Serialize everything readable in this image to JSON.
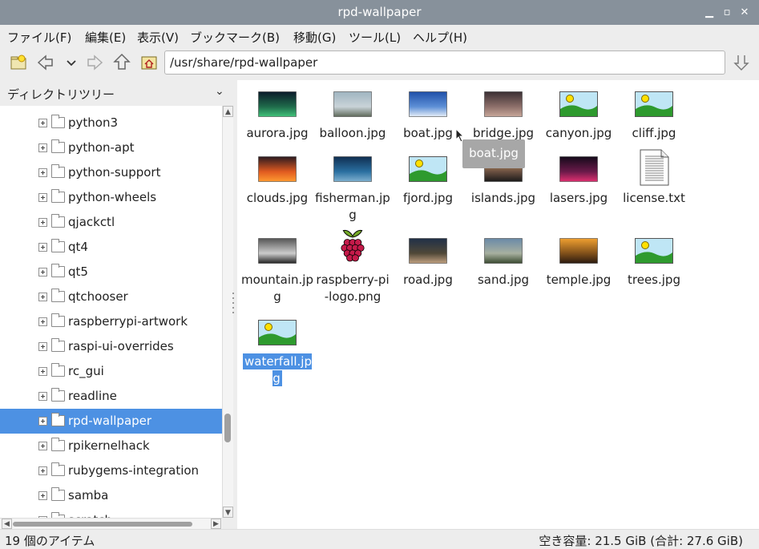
{
  "window": {
    "title": "rpd-wallpaper"
  },
  "menu": [
    "ファイル(F)",
    "編集(E)",
    "表示(V)",
    "ブックマーク(B)",
    "移動(G)",
    "ツール(L)",
    "ヘルプ(H)"
  ],
  "toolbar": {
    "path": "/usr/share/rpd-wallpaper",
    "icons": [
      "new-tab-icon",
      "back-icon",
      "history-dropdown-icon",
      "forward-icon",
      "up-icon",
      "home-icon",
      "go-icon"
    ]
  },
  "sidebar": {
    "header": "ディレクトリツリー",
    "items": [
      {
        "label": "python3",
        "selected": false
      },
      {
        "label": "python-apt",
        "selected": false
      },
      {
        "label": "python-support",
        "selected": false
      },
      {
        "label": "python-wheels",
        "selected": false
      },
      {
        "label": "qjackctl",
        "selected": false
      },
      {
        "label": "qt4",
        "selected": false
      },
      {
        "label": "qt5",
        "selected": false
      },
      {
        "label": "qtchooser",
        "selected": false
      },
      {
        "label": "raspberrypi-artwork",
        "selected": false
      },
      {
        "label": "raspi-ui-overrides",
        "selected": false
      },
      {
        "label": "rc_gui",
        "selected": false
      },
      {
        "label": "readline",
        "selected": false
      },
      {
        "label": "rpd-wallpaper",
        "selected": true
      },
      {
        "label": "rpikernelhack",
        "selected": false
      },
      {
        "label": "rubygems-integration",
        "selected": false
      },
      {
        "label": "samba",
        "selected": false
      },
      {
        "label": "scratch",
        "selected": false
      }
    ]
  },
  "files": [
    {
      "name": "aurora.jpg",
      "thumb": "photo-aurora"
    },
    {
      "name": "balloon.jpg",
      "thumb": "photo-balloon"
    },
    {
      "name": "boat.jpg",
      "thumb": "photo-boat"
    },
    {
      "name": "bridge.jpg",
      "thumb": "photo-bridge"
    },
    {
      "name": "canyon.jpg",
      "thumb": "image-placeholder"
    },
    {
      "name": "cliff.jpg",
      "thumb": "image-placeholder"
    },
    {
      "name": "clouds.jpg",
      "thumb": "photo-clouds"
    },
    {
      "name": "fisherman.jpg",
      "thumb": "photo-fisherman"
    },
    {
      "name": "fjord.jpg",
      "thumb": "image-placeholder"
    },
    {
      "name": "islands.jpg",
      "thumb": "photo-islands"
    },
    {
      "name": "lasers.jpg",
      "thumb": "photo-lasers"
    },
    {
      "name": "license.txt",
      "thumb": "text-document"
    },
    {
      "name": "mountain.jpg",
      "thumb": "photo-mountain"
    },
    {
      "name": "raspberry-pi-logo.png",
      "thumb": "raspberry-logo"
    },
    {
      "name": "road.jpg",
      "thumb": "photo-road"
    },
    {
      "name": "sand.jpg",
      "thumb": "photo-sand"
    },
    {
      "name": "temple.jpg",
      "thumb": "photo-temple"
    },
    {
      "name": "trees.jpg",
      "thumb": "image-placeholder"
    },
    {
      "name": "waterfall.jpg",
      "thumb": "image-placeholder",
      "selected": true
    }
  ],
  "tooltip": "boat.jpg",
  "status": {
    "items": "19 個のアイテム",
    "space": "空き容量: 21.5 GiB (合計: 27.6 GiB)"
  },
  "colors": {
    "titlebar": "#87919b",
    "selection": "#4d91e3"
  }
}
